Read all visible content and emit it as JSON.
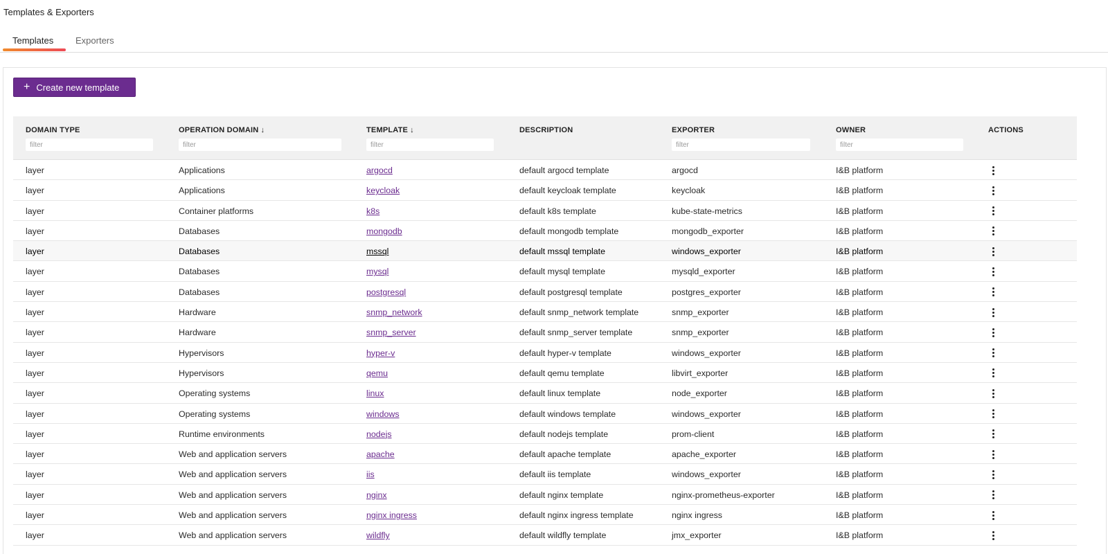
{
  "page": {
    "title": "Templates & Exporters"
  },
  "tabs": [
    {
      "label": "Templates",
      "active": true
    },
    {
      "label": "Exporters",
      "active": false
    }
  ],
  "toolbar": {
    "create_label": "Create new template",
    "create_icon": "plus-icon"
  },
  "colors": {
    "accent": "#6b2c8f",
    "tab_gradient_start": "#f08a2c",
    "tab_gradient_end": "#ee4a55"
  },
  "table": {
    "columns": [
      {
        "label": "DOMAIN TYPE",
        "sort": "",
        "filter_placeholder": "filter"
      },
      {
        "label": "OPERATION DOMAIN",
        "sort": "↓",
        "filter_placeholder": "filter"
      },
      {
        "label": "TEMPLATE",
        "sort": "↓",
        "filter_placeholder": "filter"
      },
      {
        "label": "DESCRIPTION",
        "sort": "",
        "filter_placeholder": ""
      },
      {
        "label": "EXPORTER",
        "sort": "",
        "filter_placeholder": "filter"
      },
      {
        "label": "OWNER",
        "sort": "",
        "filter_placeholder": "filter"
      },
      {
        "label": "ACTIONS",
        "sort": "",
        "filter_placeholder": ""
      }
    ],
    "rows": [
      {
        "domain_type": "layer",
        "operation_domain": "Applications",
        "template": "argocd",
        "description": "default argocd template",
        "exporter": "argocd",
        "owner": "I&B platform"
      },
      {
        "domain_type": "layer",
        "operation_domain": "Applications",
        "template": "keycloak",
        "description": "default keycloak template",
        "exporter": "keycloak",
        "owner": "I&B platform"
      },
      {
        "domain_type": "layer",
        "operation_domain": "Container platforms",
        "template": "k8s",
        "description": "default k8s template",
        "exporter": "kube-state-metrics",
        "owner": "I&B platform"
      },
      {
        "domain_type": "layer",
        "operation_domain": "Databases",
        "template": "mongodb",
        "description": "default mongodb template",
        "exporter": "mongodb_exporter",
        "owner": "I&B platform"
      },
      {
        "domain_type": "layer",
        "operation_domain": "Databases",
        "template": "mssql",
        "description": "default mssql template",
        "exporter": "windows_exporter",
        "owner": "I&B platform"
      },
      {
        "domain_type": "layer",
        "operation_domain": "Databases",
        "template": "mysql",
        "description": "default mysql template",
        "exporter": "mysqld_exporter",
        "owner": "I&B platform"
      },
      {
        "domain_type": "layer",
        "operation_domain": "Databases",
        "template": "postgresql",
        "description": "default postgresql template",
        "exporter": "postgres_exporter",
        "owner": "I&B platform"
      },
      {
        "domain_type": "layer",
        "operation_domain": "Hardware",
        "template": "snmp_network",
        "description": "default snmp_network template",
        "exporter": "snmp_exporter",
        "owner": "I&B platform"
      },
      {
        "domain_type": "layer",
        "operation_domain": "Hardware",
        "template": "snmp_server",
        "description": "default snmp_server template",
        "exporter": "snmp_exporter",
        "owner": "I&B platform"
      },
      {
        "domain_type": "layer",
        "operation_domain": "Hypervisors",
        "template": "hyper-v",
        "description": "default hyper-v template",
        "exporter": "windows_exporter",
        "owner": "I&B platform"
      },
      {
        "domain_type": "layer",
        "operation_domain": "Hypervisors",
        "template": "qemu",
        "description": "default qemu template",
        "exporter": "libvirt_exporter",
        "owner": "I&B platform"
      },
      {
        "domain_type": "layer",
        "operation_domain": "Operating systems",
        "template": "linux",
        "description": "default linux template",
        "exporter": "node_exporter",
        "owner": "I&B platform"
      },
      {
        "domain_type": "layer",
        "operation_domain": "Operating systems",
        "template": "windows",
        "description": "default windows template",
        "exporter": "windows_exporter",
        "owner": "I&B platform"
      },
      {
        "domain_type": "layer",
        "operation_domain": "Runtime environments",
        "template": "nodejs",
        "description": "default nodejs template",
        "exporter": "prom-client",
        "owner": "I&B platform"
      },
      {
        "domain_type": "layer",
        "operation_domain": "Web and application servers",
        "template": "apache",
        "description": "default apache template",
        "exporter": "apache_exporter",
        "owner": "I&B platform"
      },
      {
        "domain_type": "layer",
        "operation_domain": "Web and application servers",
        "template": "iis",
        "description": "default iis template",
        "exporter": "windows_exporter",
        "owner": "I&B platform"
      },
      {
        "domain_type": "layer",
        "operation_domain": "Web and application servers",
        "template": "nginx",
        "description": "default nginx template",
        "exporter": "nginx-prometheus-exporter",
        "owner": "I&B platform"
      },
      {
        "domain_type": "layer",
        "operation_domain": "Web and application servers",
        "template": "nginx ingress",
        "description": "default nginx ingress template",
        "exporter": "nginx ingress",
        "owner": "I&B platform"
      },
      {
        "domain_type": "layer",
        "operation_domain": "Web and application servers",
        "template": "wildfly",
        "description": "default wildfly template",
        "exporter": "jmx_exporter",
        "owner": "I&B platform"
      }
    ],
    "hovered_row": 4,
    "row_action_icon": "kebab-menu-icon"
  }
}
